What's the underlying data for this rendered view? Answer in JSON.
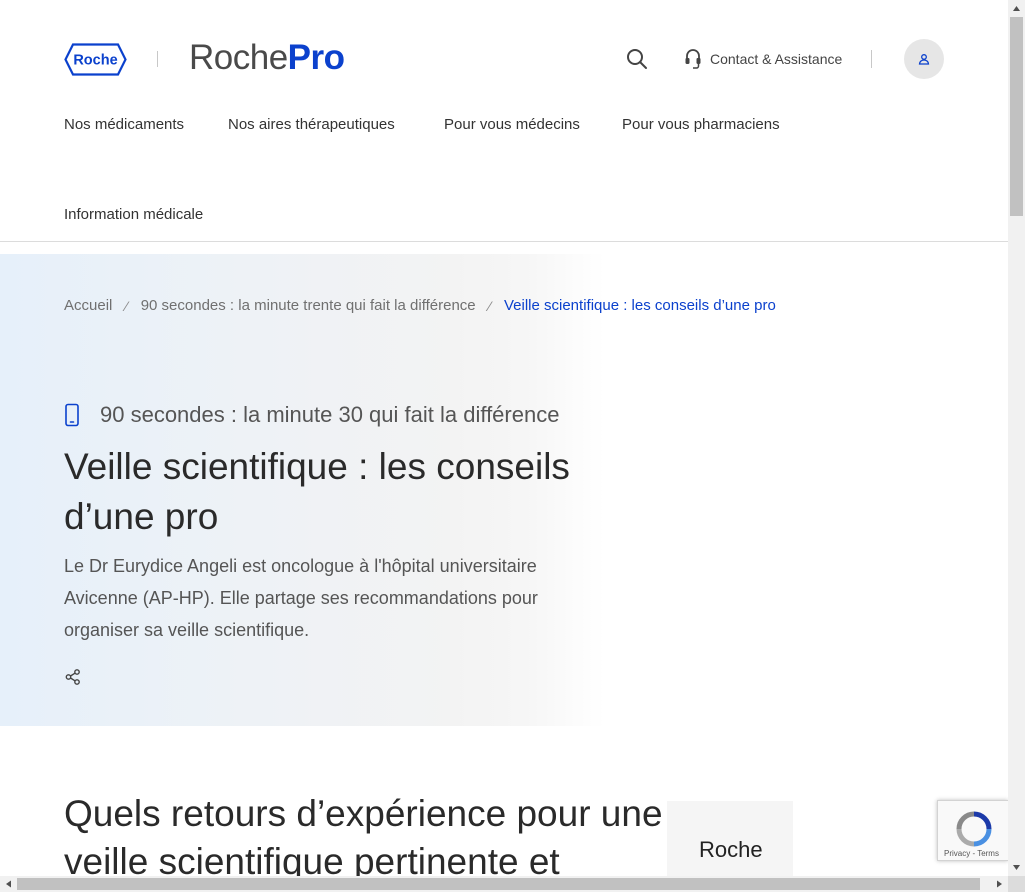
{
  "header": {
    "logo_text": "Roche",
    "brand_part1": "Roche",
    "brand_part2": "Pro",
    "contact_label": "Contact & Assistance",
    "nav": [
      {
        "label": "Nos médicaments"
      },
      {
        "label": "Nos aires thérapeutiques"
      },
      {
        "label": "Pour vous médecins"
      },
      {
        "label": "Pour vous pharmaciens"
      },
      {
        "label": "Information médicale"
      }
    ]
  },
  "breadcrumb": [
    {
      "label": "Accueil"
    },
    {
      "label": "90 secondes : la minute trente qui fait la différence"
    },
    {
      "label": "Veille scientifique : les conseils d’une pro"
    }
  ],
  "hero": {
    "kicker": "90 secondes : la minute 30 qui fait la différence",
    "title": "Veille scientifique : les conseils d’une pro",
    "description": "Le Dr Eurydice Angeli est oncologue à l'hôpital universitaire Avicenne (AP-HP). Elle partage ses recommandations pour organiser sa veille scientifique."
  },
  "content": {
    "section_title": "Quels retours d’expérience pour une veille scientifique pertinente et",
    "side_card_text": "Roche"
  },
  "recaptcha": {
    "links": "Privacy - Terms"
  },
  "colors": {
    "accent": "#0b41cd",
    "text": "#333333",
    "border": "#dcdcdc"
  }
}
